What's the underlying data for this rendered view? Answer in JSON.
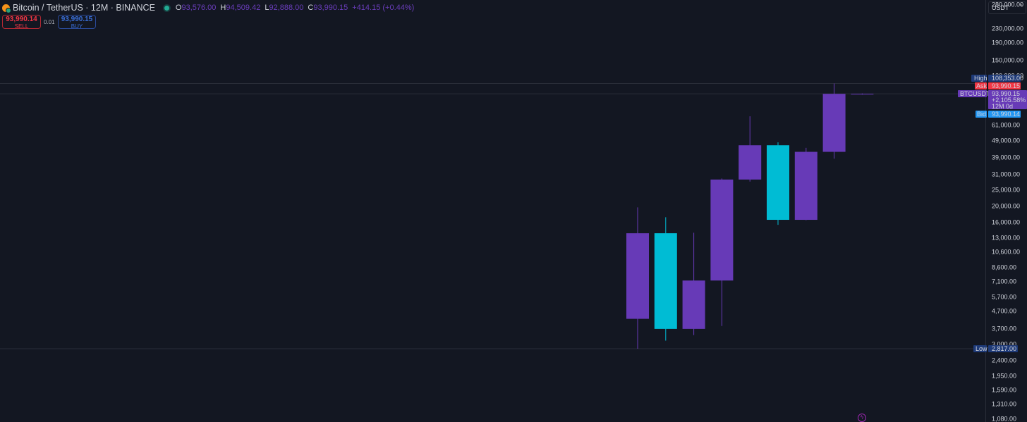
{
  "header": {
    "title": "Bitcoin / TetherUS · 12M · BINANCE",
    "ohlc": [
      {
        "key": "O",
        "value": "93,576.00"
      },
      {
        "key": "H",
        "value": "94,509.42"
      },
      {
        "key": "L",
        "value": "92,888.00"
      },
      {
        "key": "C",
        "value": "93,990.15"
      }
    ],
    "change": "+414.15 (+0.44%)"
  },
  "trade": {
    "sell_price": "93,990.14",
    "sell_label": "SELL",
    "quantity": "0.01",
    "buy_price": "93,990.15",
    "buy_label": "BUY"
  },
  "currency": "USDT",
  "colors": {
    "background": "#131722",
    "candle_up": "#673ab7",
    "candle_down": "#00bcd4",
    "ask": "#f23645",
    "bid": "#2196f3",
    "high_low": "#1e3a78",
    "symbol": "#673ab7"
  },
  "chart_data": {
    "type": "candlestick",
    "scale": "log",
    "y_ticks": [
      "280,000.00",
      "230,000.00",
      "190,000.00",
      "150,000.00",
      "120,000.00",
      "61,000.00",
      "49,000.00",
      "39,000.00",
      "31,000.00",
      "25,000.00",
      "20,000.00",
      "16,000.00",
      "13,000.00",
      "10,600.00",
      "8,600.00",
      "7,100.00",
      "5,700.00",
      "4,700.00",
      "3,700.00",
      "3,000.00",
      "2,400.00",
      "1,950.00",
      "1,590.00",
      "1,310.00",
      "1,080.00"
    ],
    "candles": [
      {
        "open": 4250,
        "high": 19700,
        "low": 2817,
        "close": 13800
      },
      {
        "open": 13800,
        "high": 17200,
        "low": 3150,
        "close": 3700
      },
      {
        "open": 3700,
        "high": 13900,
        "low": 3400,
        "close": 7200
      },
      {
        "open": 7200,
        "high": 29300,
        "low": 3850,
        "close": 28900
      },
      {
        "open": 28900,
        "high": 69000,
        "low": 28100,
        "close": 46300
      },
      {
        "open": 46300,
        "high": 48200,
        "low": 15500,
        "close": 16600
      },
      {
        "open": 16600,
        "high": 44700,
        "low": 16500,
        "close": 42300
      },
      {
        "open": 42300,
        "high": 108353,
        "low": 38500,
        "close": 93990.15
      },
      {
        "open": 93576,
        "high": 94509.42,
        "low": 92888,
        "close": 93990.15
      }
    ],
    "price_lines": {
      "high": {
        "label": "High",
        "value": "108,353.00",
        "price": 108353
      },
      "ask": {
        "label": "Ask",
        "value": "93,990.15",
        "price": 93990.15
      },
      "last": {
        "label": "BTCUSDT",
        "value": "93,990.15",
        "change": "+2,105.58%",
        "timer": "12M 0d",
        "price": 93990.15
      },
      "bid": {
        "label": "Bid",
        "value": "93,990.14",
        "price": 93990.14
      },
      "low": {
        "label": "Low",
        "value": "2,817.00",
        "price": 2817
      }
    }
  }
}
